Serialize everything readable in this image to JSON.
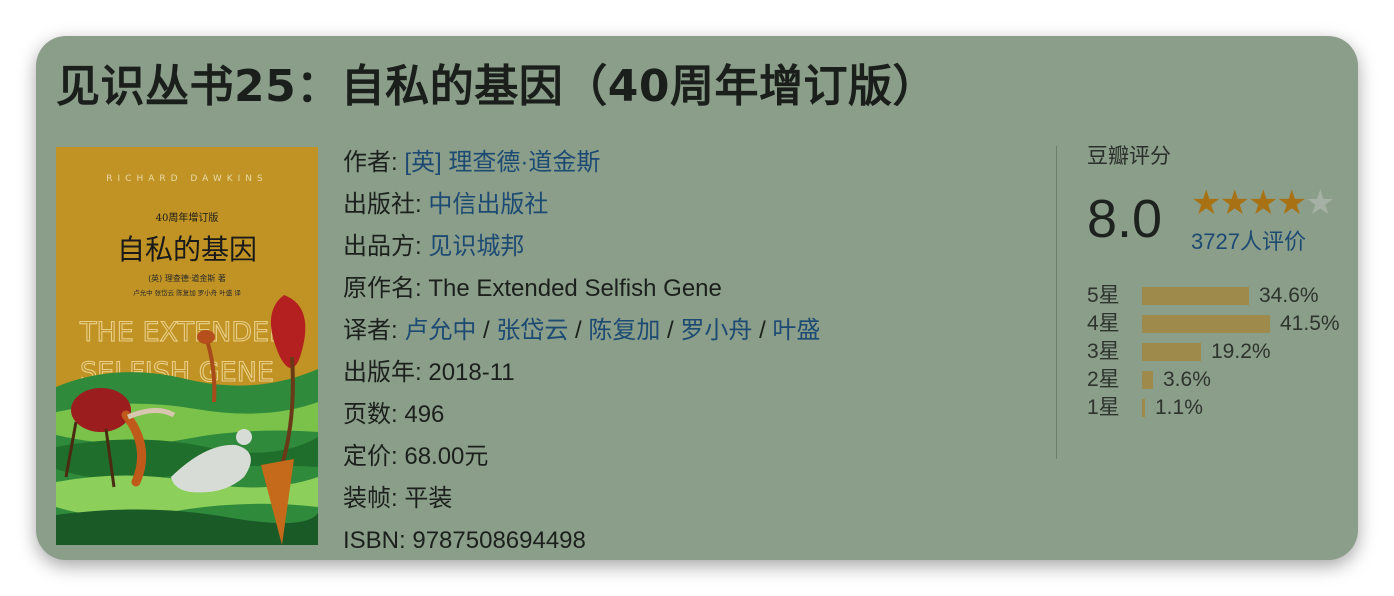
{
  "book": {
    "title": "见识丛书25：自私的基因（40周年增订版）",
    "cover": {
      "author_en": "RICHARD DAWKINS",
      "edition": "40周年增订版",
      "title_cn": "自私的基因",
      "author_cn": "(英) 理查德·道金斯 著",
      "translators": "卢允中 张岱云 陈复加 罗小舟 叶盛 译",
      "title_en_line1": "THE EXTENDED",
      "title_en_line2": "SELFISH GENE"
    },
    "info": {
      "author_label": "作者:",
      "author_value": "[英] 理查德·道金斯",
      "publisher_label": "出版社:",
      "publisher_value": "中信出版社",
      "producer_label": "出品方:",
      "producer_value": "见识城邦",
      "original_title_label": "原作名:",
      "original_title_value": "The Extended Selfish Gene",
      "translators_label": "译者:",
      "translators": [
        "卢允中",
        "张岱云",
        "陈复加",
        "罗小舟",
        "叶盛"
      ],
      "translators_sep": "/",
      "year_label": "出版年:",
      "year_value": "2018-11",
      "pages_label": "页数:",
      "pages_value": "496",
      "price_label": "定价:",
      "price_value": "68.00元",
      "binding_label": "装帧:",
      "binding_value": "平装",
      "isbn_label": "ISBN:",
      "isbn_value": "9787508694498"
    },
    "rating": {
      "label": "豆瓣评分",
      "score": "8.0",
      "stars_filled": 4,
      "stars_total": 5,
      "star_glyph": "★",
      "count_text": "3727人评价",
      "distribution": [
        {
          "label": "5星",
          "percent": 34.6,
          "text": "34.6%"
        },
        {
          "label": "4星",
          "percent": 41.5,
          "text": "41.5%"
        },
        {
          "label": "3星",
          "percent": 19.2,
          "text": "19.2%"
        },
        {
          "label": "2星",
          "percent": 3.6,
          "text": "3.6%"
        },
        {
          "label": "1星",
          "percent": 1.1,
          "text": "1.1%"
        }
      ]
    },
    "colors": {
      "card_background": "#8a9e89",
      "link": "#1d4a73",
      "star": "#a87214",
      "bar": "#9e8a4a",
      "cover": "#c09324"
    }
  }
}
